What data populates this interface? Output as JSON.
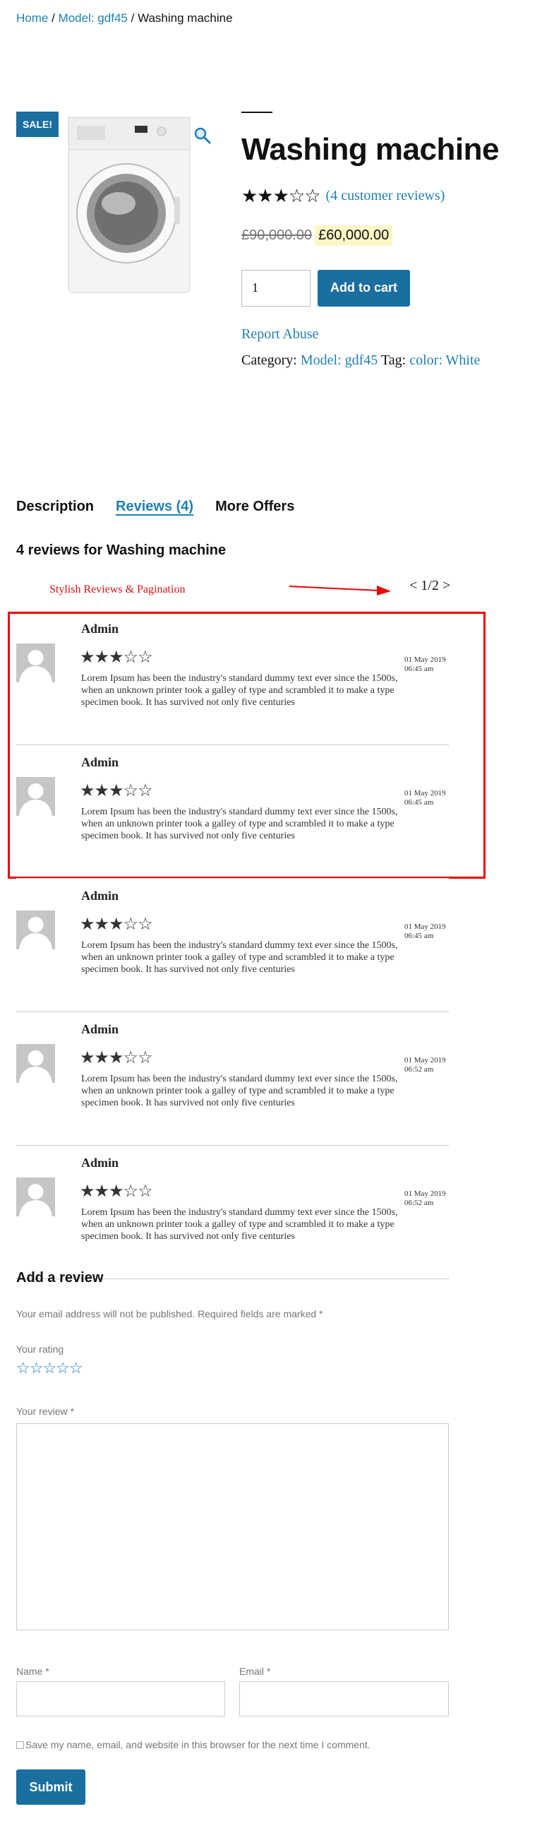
{
  "breadcrumb": {
    "home": "Home",
    "sep1": "/",
    "category": "Model: gdf45",
    "sep2": "/",
    "current": "Washing machine"
  },
  "product": {
    "sale_badge": "SALE!",
    "title": "Washing machine",
    "rating": 3,
    "rating_max": 5,
    "stars_text": "★★★☆☆",
    "review_link": "(4 customer reviews)",
    "old_price": "£90,000.00",
    "new_price": "£60,000.00",
    "quantity": "1",
    "add_to_cart": "Add to cart",
    "report_abuse": "Report Abuse",
    "category_label": "Category:",
    "category_value": "Model: gdf45",
    "tag_label": "Tag:",
    "tag_value": "color: White"
  },
  "tabs": [
    {
      "label": "Description",
      "active": false
    },
    {
      "label": "Reviews (4)",
      "active": true
    },
    {
      "label": "More Offers",
      "active": false
    }
  ],
  "reviews_section": {
    "title": "4 reviews for Washing machine",
    "annotation": "Stylish Reviews & Pagination",
    "pager": "< 1/2 >"
  },
  "reviews": [
    {
      "author": "Admin",
      "rating": 3,
      "stars_text": "★★★☆☆",
      "date": "01 May 2019",
      "time": "06:45 am",
      "text": "Lorem Ipsum has been the industry's standard dummy text ever since the 1500s, when an unknown printer took a galley of type and scrambled it to make a type specimen book. It has survived not only five centuries"
    },
    {
      "author": "Admin",
      "rating": 3,
      "stars_text": "★★★☆☆",
      "date": "01 May 2019",
      "time": "06:45 am",
      "text": "Lorem Ipsum has been the industry's standard dummy text ever since the 1500s, when an unknown printer took a galley of type and scrambled it to make a type specimen book. It has survived not only five centuries"
    },
    {
      "author": "Admin",
      "rating": 3,
      "stars_text": "★★★☆☆",
      "date": "01 May 2019",
      "time": "06:45 am",
      "text": "Lorem Ipsum has been the industry's standard dummy text ever since the 1500s, when an unknown printer took a galley of type and scrambled it to make a type specimen book. It has survived not only five centuries"
    },
    {
      "author": "Admin",
      "rating": 3,
      "stars_text": "★★★☆☆",
      "date": "01 May 2019",
      "time": "06:52 am",
      "text": "Lorem Ipsum has been the industry's standard dummy text ever since the 1500s, when an unknown printer took a galley of type and scrambled it to make a type specimen book. It has survived not only five centuries"
    },
    {
      "author": "Admin",
      "rating": 3,
      "stars_text": "★★★☆☆",
      "date": "01 May 2019",
      "time": "06:52 am",
      "text": "Lorem Ipsum has been the industry's standard dummy text ever since the 1500s, when an unknown printer took a galley of type and scrambled it to make a type specimen book. It has survived not only five centuries"
    }
  ],
  "review_form": {
    "title": "Add a review",
    "notice": "Your email address will not be published. Required fields are marked *",
    "rating_label": "Your rating",
    "rating_stars": "☆☆☆☆☆",
    "review_label": "Your review *",
    "name_label": "Name *",
    "email_label": "Email *",
    "save_label": "Save my name, email, and website in this browser for the next time I comment.",
    "submit": "Submit"
  },
  "colors": {
    "accent": "#1a6ea0",
    "link": "#1f7fb5",
    "price_highlight": "#fdf6c7",
    "annotation": "#e00000"
  }
}
